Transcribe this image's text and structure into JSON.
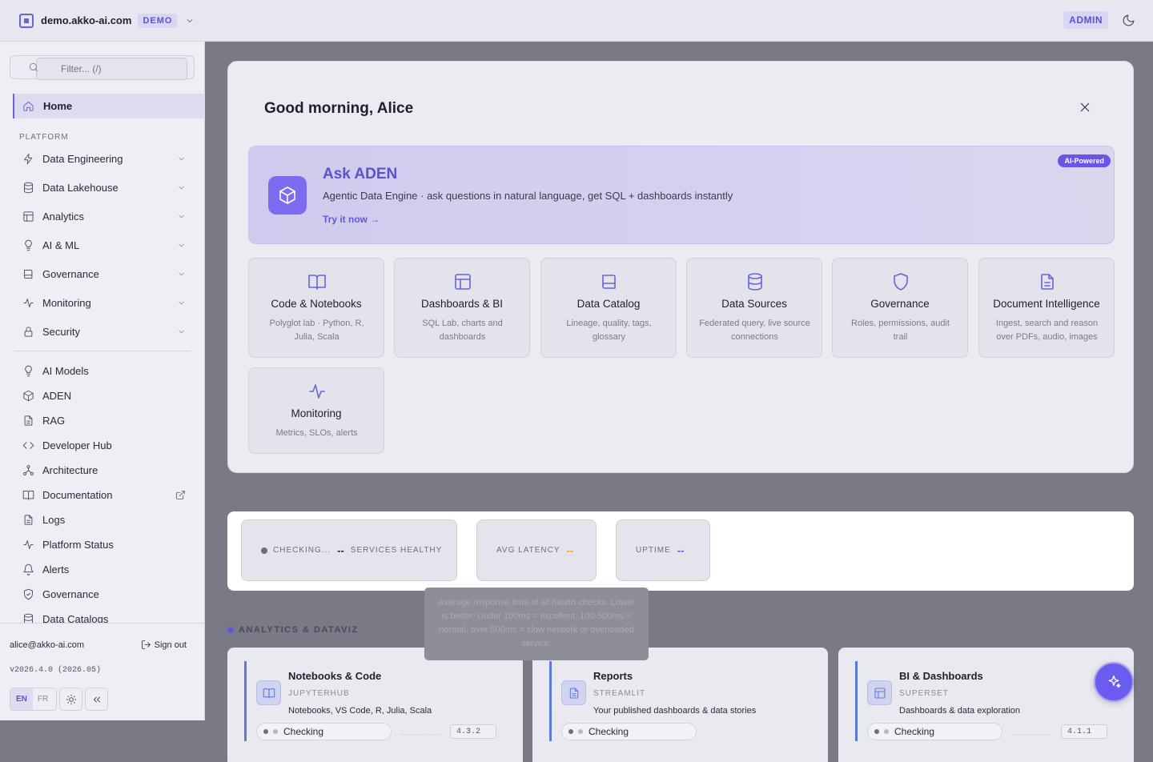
{
  "topbar": {
    "host": "demo.akko-ai.com",
    "env_badge": "DEMO",
    "role_badge": "ADMIN"
  },
  "sidebar": {
    "filter_placeholder": "Filter... (/)",
    "home": "Home",
    "section_label": "PLATFORM",
    "groups": [
      {
        "label": "Data Engineering",
        "icon": "zap-icon"
      },
      {
        "label": "Data Lakehouse",
        "icon": "database-icon"
      },
      {
        "label": "Analytics",
        "icon": "layout-icon"
      },
      {
        "label": "AI & ML",
        "icon": "lightbulb-icon"
      },
      {
        "label": "Governance",
        "icon": "book-icon"
      },
      {
        "label": "Monitoring",
        "icon": "activity-icon"
      },
      {
        "label": "Security",
        "icon": "lock-icon"
      }
    ],
    "links": [
      {
        "label": "AI Models",
        "icon": "lightbulb-icon"
      },
      {
        "label": "ADEN",
        "icon": "cube-icon"
      },
      {
        "label": "RAG",
        "icon": "file-icon"
      },
      {
        "label": "Developer Hub",
        "icon": "code-icon"
      },
      {
        "label": "Architecture",
        "icon": "network-icon"
      },
      {
        "label": "Documentation",
        "icon": "book-open-icon"
      },
      {
        "label": "Logs",
        "icon": "file-text-icon"
      },
      {
        "label": "Platform Status",
        "icon": "activity-icon"
      },
      {
        "label": "Alerts",
        "icon": "bell-icon"
      },
      {
        "label": "Governance",
        "icon": "shield-icon"
      },
      {
        "label": "Data Catalogs",
        "icon": "database-icon"
      }
    ],
    "footer": {
      "email": "alice@akko-ai.com",
      "sign_out": "Sign out",
      "version": "v2026.4.0 (2026.05)",
      "lang_en": "EN",
      "lang_fr": "FR"
    }
  },
  "welcome": {
    "greeting": "Good morning, Alice",
    "aden": {
      "title": "Ask ADEN",
      "subtitle": "Agentic Data Engine · ask questions in natural language, get SQL + dashboards instantly",
      "cta": "Try it now →",
      "badge": "AI-Powered"
    },
    "tiles": [
      {
        "title": "Code & Notebooks",
        "desc": "Polyglot lab · Python, R, Julia, Scala",
        "icon": "book-open-icon"
      },
      {
        "title": "Dashboards & BI",
        "desc": "SQL Lab, charts and dashboards",
        "icon": "layout-icon"
      },
      {
        "title": "Data Catalog",
        "desc": "Lineage, quality, tags, glossary",
        "icon": "book-icon"
      },
      {
        "title": "Data Sources",
        "desc": "Federated query, live source connections",
        "icon": "database-icon"
      },
      {
        "title": "Governance",
        "desc": "Roles, permissions, audit trail",
        "icon": "shield-icon"
      },
      {
        "title": "Document Intelligence",
        "desc": "Ingest, search and reason over PDFs, audio, images",
        "icon": "file-text-icon"
      },
      {
        "title": "Monitoring",
        "desc": "Metrics, SLOs, alerts",
        "icon": "activity-icon"
      }
    ]
  },
  "status": {
    "checking": "CHECKING...",
    "health_value": "--",
    "health_label": "SERVICES HEALTHY",
    "latency_label": "AVG LATENCY",
    "latency_value": "--",
    "latency_color": "#f0a020",
    "uptime_label": "UPTIME",
    "uptime_value": "--",
    "uptime_color": "#5b54c9",
    "tooltip": "Average response time of all health checks. Lower is better. Under 100ms = excellent, 100-500ms = normal, over 500ms = slow network or overloaded service."
  },
  "analytics": {
    "heading": "ANALYTICS & DATAVIZ",
    "services": [
      {
        "title": "Notebooks & Code",
        "tech": "JUPYTERHUB",
        "desc": "Notebooks, VS Code, R, Julia, Scala",
        "status": "Checking",
        "version": "4.3.2"
      },
      {
        "title": "Reports",
        "tech": "STREAMLIT",
        "desc": "Your published dashboards & data stories",
        "status": "Checking",
        "version": ""
      },
      {
        "title": "BI & Dashboards",
        "tech": "SUPERSET",
        "desc": "Dashboards & data exploration",
        "status": "Checking",
        "version": "4.1.1"
      }
    ]
  }
}
